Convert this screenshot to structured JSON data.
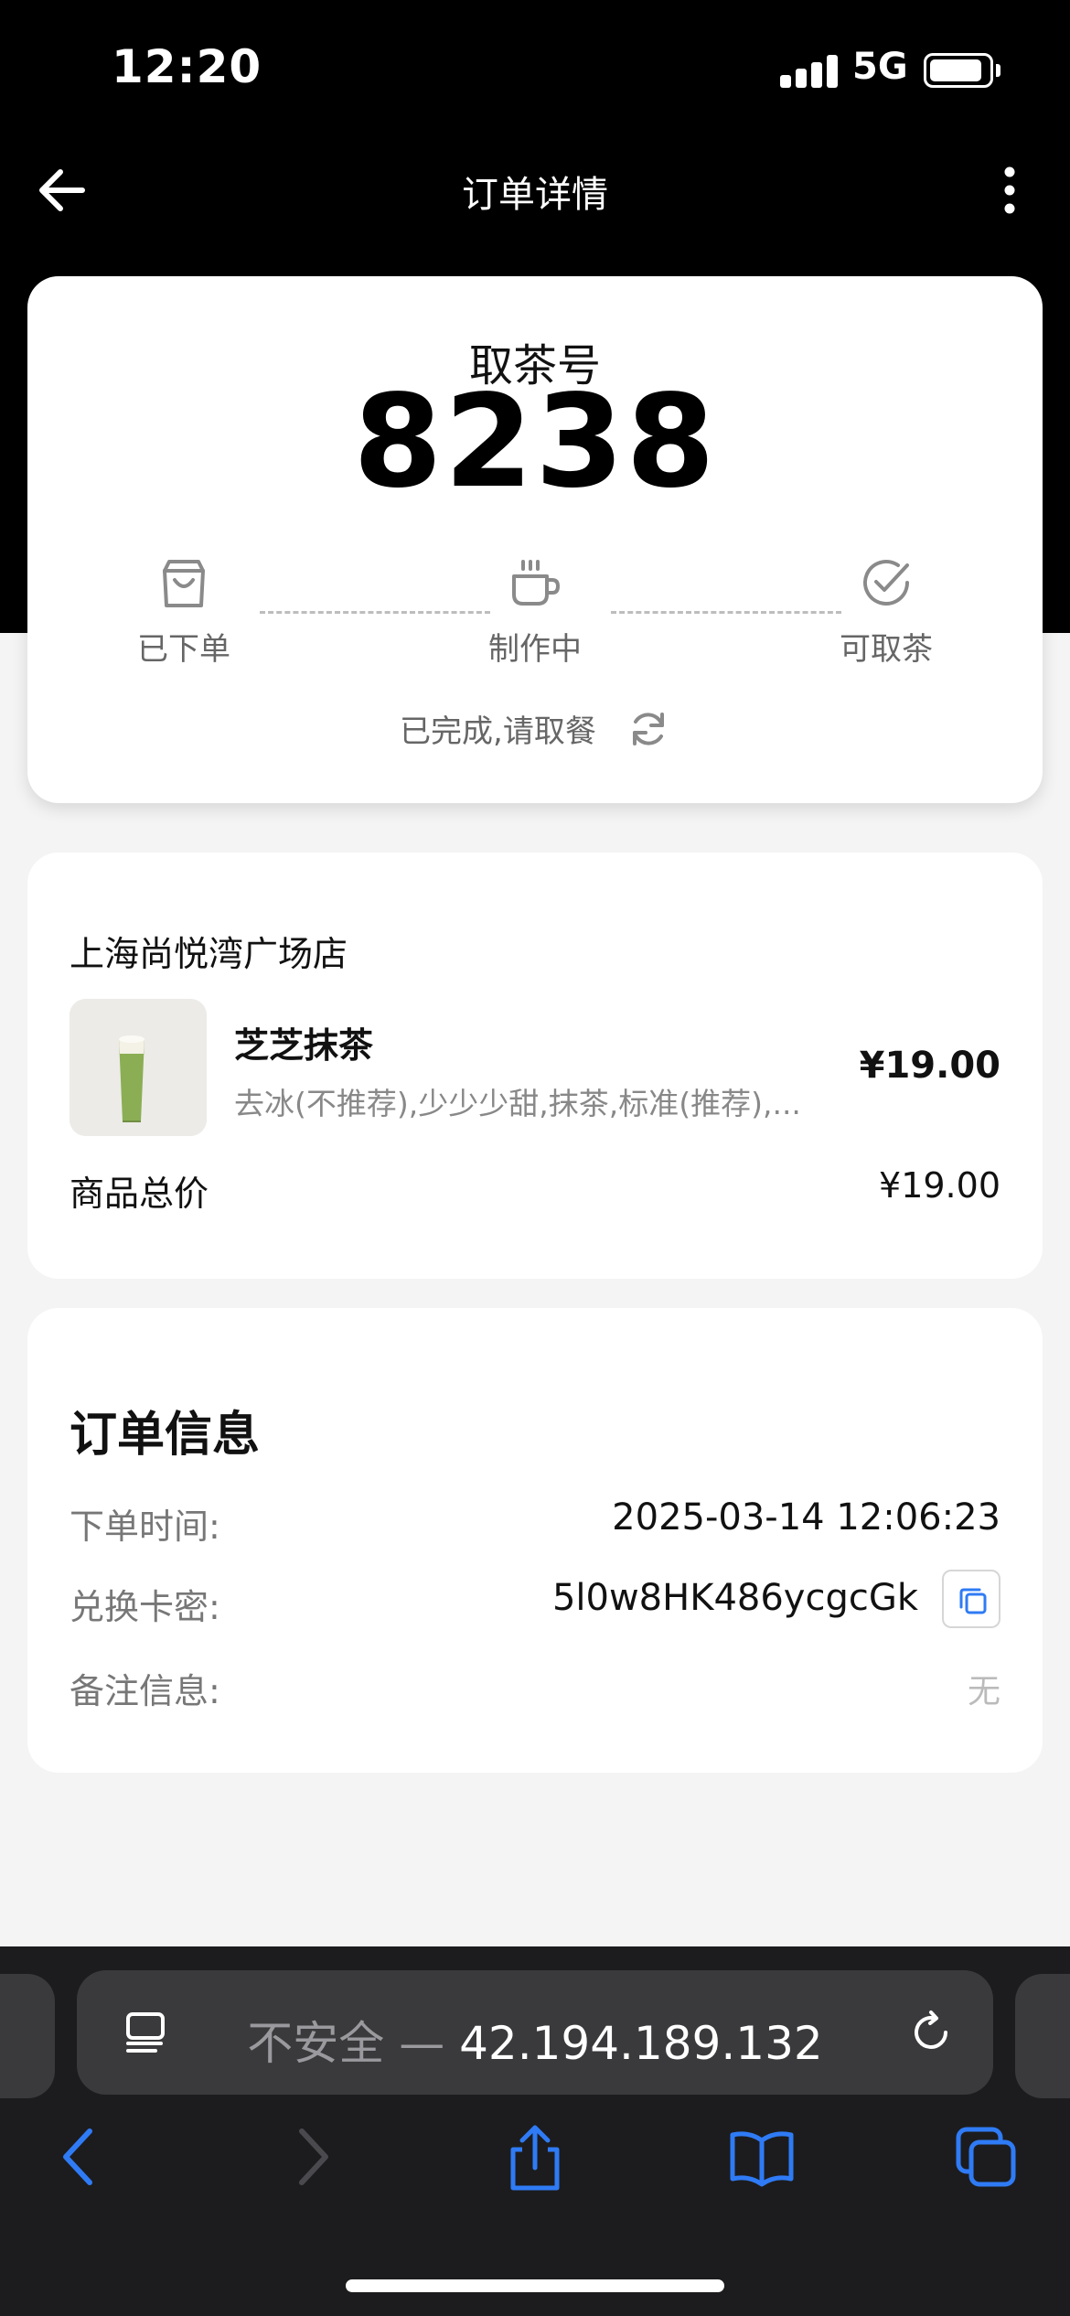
{
  "status_bar": {
    "time": "12:20",
    "network": "5G"
  },
  "nav": {
    "title": "订单详情"
  },
  "pickup": {
    "label": "取茶号",
    "number": "8238",
    "steps": [
      {
        "label": "已下单",
        "icon": "shopping-bag-icon"
      },
      {
        "label": "制作中",
        "icon": "coffee-cup-icon"
      },
      {
        "label": "可取茶",
        "icon": "check-circle-icon"
      }
    ],
    "status_text": "已完成,请取餐"
  },
  "items": {
    "store_name": "上海尚悦湾广场店",
    "product": {
      "name": "芝芝抹茶",
      "spec": "去冰(不推荐),少少少甜,抹茶,标准(推荐),...",
      "price": "¥19.00"
    },
    "total_label": "商品总价",
    "total_value": "¥19.00"
  },
  "order_info": {
    "title": "订单信息",
    "order_time_label": "下单时间:",
    "order_time_value": "2025-03-14 12:06:23",
    "redeem_code_label": "兑换卡密:",
    "redeem_code_value": "5l0w8HK486ycgcGk",
    "note_label": "备注信息:",
    "note_value": "无"
  },
  "browser": {
    "address_warning": "不安全",
    "address_separator": " — ",
    "address_host": "42.194.189.132"
  },
  "colors": {
    "accent": "#2f7bf5",
    "header_bg": "#000000",
    "page_bg": "#f4f4f4"
  }
}
